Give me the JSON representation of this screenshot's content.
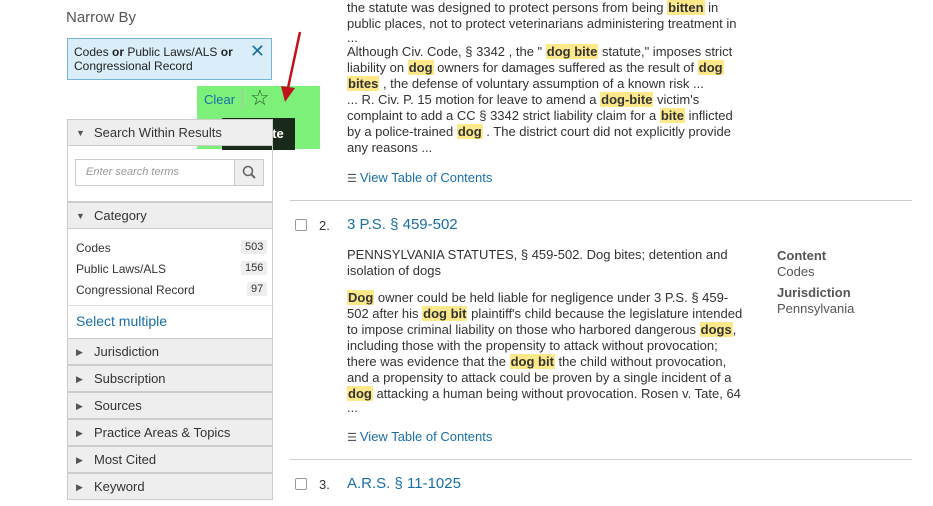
{
  "sidebar": {
    "narrow_title": "Narrow By",
    "chip": {
      "part1": "Codes",
      "or1": "or",
      "part2": "Public Laws/ALS",
      "or2": "or",
      "part3": "Congressional Record"
    },
    "clear": "Clear",
    "tooltip": "Favorite",
    "search_within": "Search Within Results",
    "search_placeholder": "Enter search terms",
    "category_label": "Category",
    "categories": [
      {
        "label": "Codes",
        "count": "503"
      },
      {
        "label": "Public Laws/ALS",
        "count": "156"
      },
      {
        "label": "Congressional Record",
        "count": "97"
      }
    ],
    "select_multiple": "Select multiple",
    "facets": [
      "Jurisdiction",
      "Subscription",
      "Sources",
      "Practice Areas & Topics",
      "Most Cited",
      "Keyword"
    ]
  },
  "results": {
    "toc_label": "View Table of Contents",
    "r1": {
      "line1a": "the statute was designed to protect persons from being ",
      "line1b": "bitten",
      "line1c": " in",
      "line2": "public places, not to protect veterinarians administering treatment in",
      "line3": "...",
      "p2a": "Although Civ. Code, § 3342 , the \" ",
      "p2b": "dog bite",
      "p2c": " statute,\" imposes strict",
      "p3a": "liability on ",
      "p3b": "dog",
      "p3c": " owners for damages suffered as the result of ",
      "p3d": "dog",
      "p4a": "bites",
      "p4b": " , the defense of voluntary assumption of a known risk ...",
      "p5a": "... R. Civ. P. 15 motion for leave to amend a ",
      "p5b": "dog-bite",
      "p5c": " victim's",
      "p6a": "complaint to add a CC § 3342 strict liability claim for a ",
      "p6b": "bite",
      "p6c": " inflicted",
      "p7a": "by a police-trained ",
      "p7b": "dog",
      "p7c": " . The district court did not explicitly provide",
      "p8": "any reasons ..."
    },
    "r2": {
      "num": "2.",
      "title": "3 P.S. § 459-502",
      "summary1": "PENNSYLVANIA STATUTES, § 459-502. Dog bites; detention and",
      "summary2": "isolation of dogs",
      "b1a": "Dog",
      "b1b": " owner could be held liable for negligence under 3 P.S. § 459-",
      "b2a": "502 after his ",
      "b2b": "dog bit",
      "b2c": " plaintiff's child because the legislature intended",
      "b3a": "to impose criminal liability on those who harbored dangerous ",
      "b3b": "dogs",
      "b3c": ",",
      "b4": "including those with the propensity to attack without provocation;",
      "b5a": "there was evidence that the ",
      "b5b": "dog bit",
      "b5c": " the child without provocation,",
      "b6": "and a propensity to attack could be proven by a single incident of a",
      "b7a": "dog",
      "b7b": " attacking a human being without provocation. Rosen v. Tate, 64",
      "b8": "...",
      "meta_content_h": "Content",
      "meta_content_v": "Codes",
      "meta_jur_h": "Jurisdiction",
      "meta_jur_v": "Pennsylvania"
    },
    "r3": {
      "num": "3.",
      "title": "A.R.S. § 11-1025"
    }
  },
  "colors": {
    "accent": "#1a6ea8",
    "highlight": "#fde88a",
    "annotation_box": "#7df07a",
    "arrow": "#c0141c"
  }
}
